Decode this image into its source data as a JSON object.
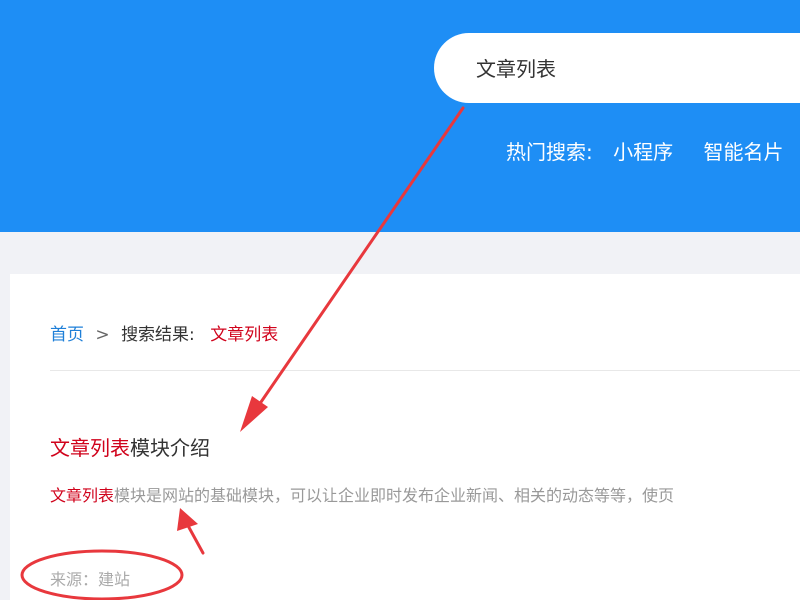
{
  "search": {
    "value": "文章列表"
  },
  "hot_search": {
    "label": "热门搜索:",
    "items": [
      "小程序",
      "智能名片"
    ]
  },
  "breadcrumb": {
    "home": "首页",
    "separator": ">",
    "label": "搜索结果:",
    "keyword": "文章列表"
  },
  "result": {
    "title_highlight": "文章列表",
    "title_rest": "模块介绍",
    "desc_highlight": "文章列表",
    "desc_rest": "模块是网站的基础模块，可以让企业即时发布企业新闻、相关的动态等等，使页",
    "source": "来源：建站"
  },
  "colors": {
    "header": "#1e8ef5",
    "highlight": "#d0021b",
    "annotation": "#e8383d"
  }
}
